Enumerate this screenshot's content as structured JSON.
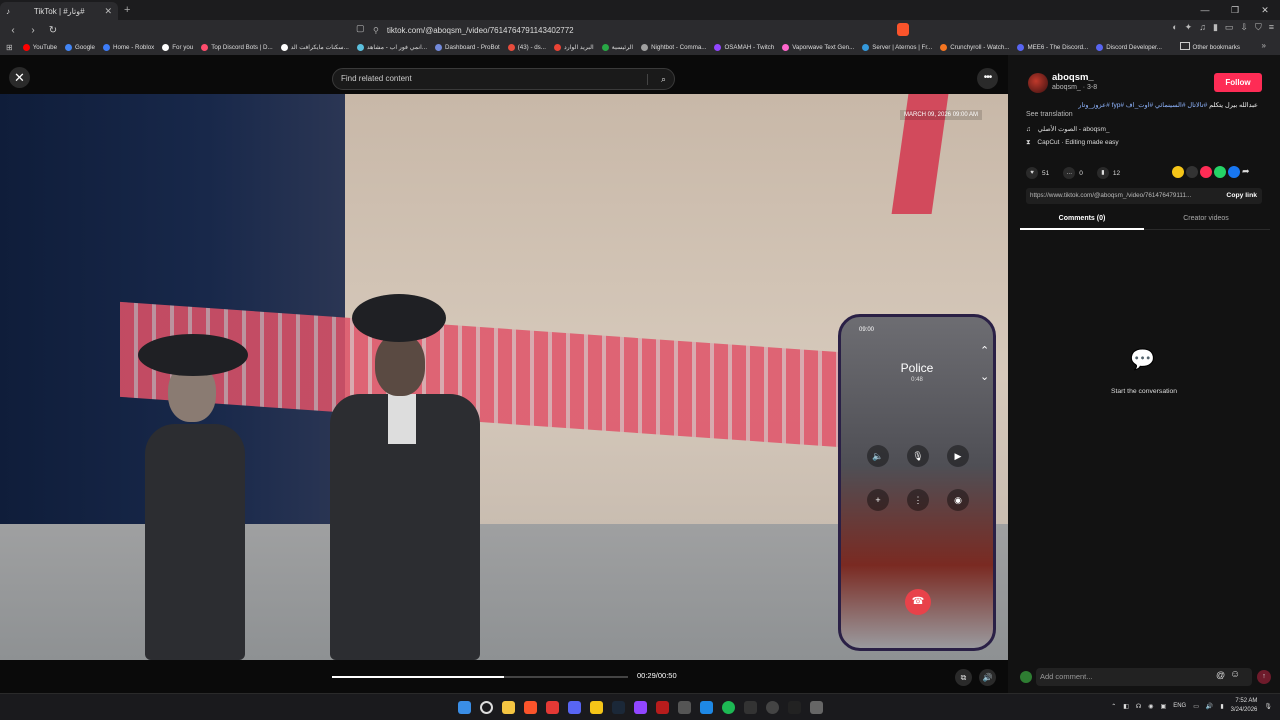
{
  "browser": {
    "tab_title": "TikTok | #وتار#",
    "url": "tiktok.com/@aboqsm_/video/7614764791143402772",
    "bookmarks": [
      {
        "label": "YouTube",
        "color": "#ff0000"
      },
      {
        "label": "Google",
        "color": "#4285f4"
      },
      {
        "label": "Home - Roblox",
        "color": "#3d7cf7"
      },
      {
        "label": "For you",
        "color": "#ffffff"
      },
      {
        "label": "Top Discord Bots | D...",
        "color": "#ff4d6d"
      },
      {
        "label": "سكنات مايكرافت الد...",
        "color": "#ffffff"
      },
      {
        "label": "انمي فور اب - مشاهد...",
        "color": "#5bc0de"
      },
      {
        "label": "Dashboard - ProBot",
        "color": "#7289da"
      },
      {
        "label": "(43) - ds...",
        "color": "#e74c3c"
      },
      {
        "label": "البريد الوارد",
        "color": "#ea4335"
      },
      {
        "label": "الرئيسية",
        "color": "#28a745"
      },
      {
        "label": "Nightbot - Comma...",
        "color": "#a0a0a0"
      },
      {
        "label": "OSAMAH - Twitch",
        "color": "#9146ff"
      },
      {
        "label": "Vaporwave Text Gen...",
        "color": "#ff66cc"
      },
      {
        "label": "Server | Aternos | Fr...",
        "color": "#3498db"
      },
      {
        "label": "Crunchyroll - Watch...",
        "color": "#f47521"
      },
      {
        "label": "MEE6 - The Discord...",
        "color": "#5865f2"
      },
      {
        "label": "Discord Developer...",
        "color": "#5865f2"
      }
    ],
    "other_bookmarks": "Other bookmarks"
  },
  "player": {
    "search_placeholder": "Find related content",
    "timecode": "00:29/00:50",
    "progress": 0.58,
    "stamp": "MARCH 09, 2026   09:00 AM",
    "phone": {
      "status_time": "09:00",
      "caller": "Police",
      "duration": "0:48"
    }
  },
  "author": {
    "username": "aboqsm_",
    "handle": "aboqsm_ · 3-8",
    "follow_label": "Follow",
    "description_text": "عبدالله بيرل يتكلم",
    "hashtags": "#تالاتال #السينمائي #اوت_اف #fyp #عزوز_وتار",
    "see_translation": "See translation",
    "music": "الصوت الأصلي - aboqsm_",
    "capcut": "CapCut · Editing made easy",
    "likes": "51",
    "comments": "0",
    "saves": "12",
    "link": "https://www.tiktok.com/@aboqsm_/video/761476479111...",
    "copy_link": "Copy link"
  },
  "tabs": {
    "comments": "Comments (0)",
    "creator_videos": "Creator videos"
  },
  "comments_empty": "Start the conversation",
  "comment_input_placeholder": "Add comment...",
  "taskbar": {
    "lang": "ENG",
    "time": "7:52 AM",
    "date": "3/24/2026"
  },
  "colors": {
    "accent": "#fe2c55",
    "hashtag": "#8fb5ff"
  }
}
